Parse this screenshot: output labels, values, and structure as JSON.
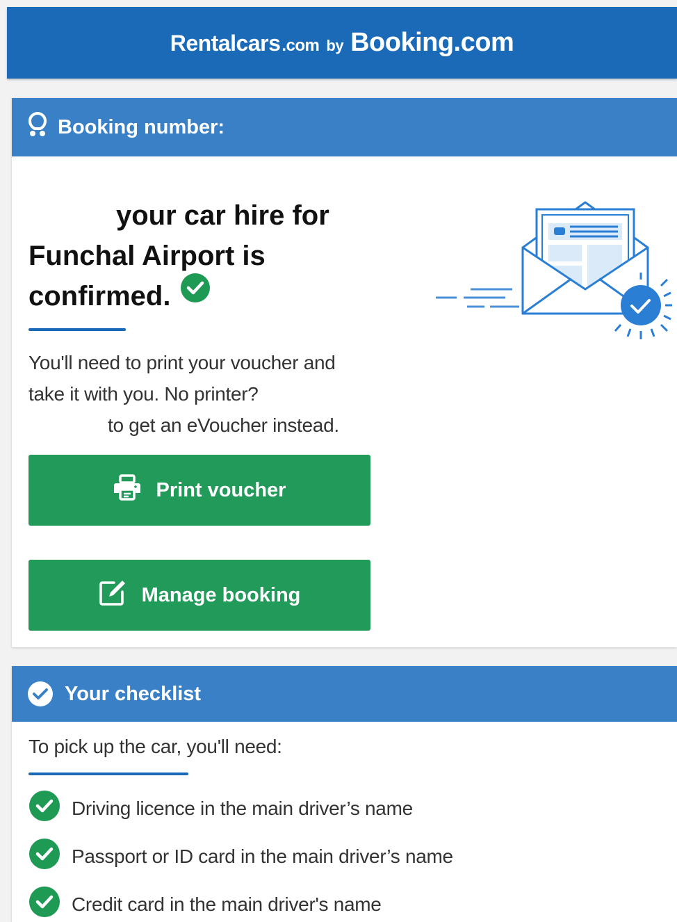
{
  "brand": {
    "rentalcars": "Rentalcars",
    "rentalcars_suffix": ".com",
    "by": "by",
    "booking": "Booking.com"
  },
  "booking": {
    "header_label": "Booking number:",
    "headline_line1": "your car hire for",
    "headline_line2": "Funchal Airport is",
    "headline_line3": "confirmed.",
    "voucher_line1": "You'll need to print your voucher and",
    "voucher_line2": "take it with you. No printer?",
    "voucher_line3": "to get an eVoucher instead.",
    "print_button": "Print voucher",
    "manage_button": "Manage booking"
  },
  "checklist": {
    "header_label": "Your checklist",
    "intro": "To pick up the car, you'll need:",
    "items": [
      "Driving licence in the main driver’s name",
      "Passport or ID card in the main driver’s name",
      "Credit card in the main driver's name"
    ]
  },
  "colors": {
    "brand_blue": "#1b6ab8",
    "header_blue": "#3a80c6",
    "button_green": "#229a5a",
    "check_green": "#1e9a55"
  },
  "icons": {
    "booking_header": "booking-pin-icon",
    "print": "printer-icon",
    "manage": "edit-icon",
    "checklist_header": "check-circle-icon",
    "list_item": "check-circle-icon"
  }
}
